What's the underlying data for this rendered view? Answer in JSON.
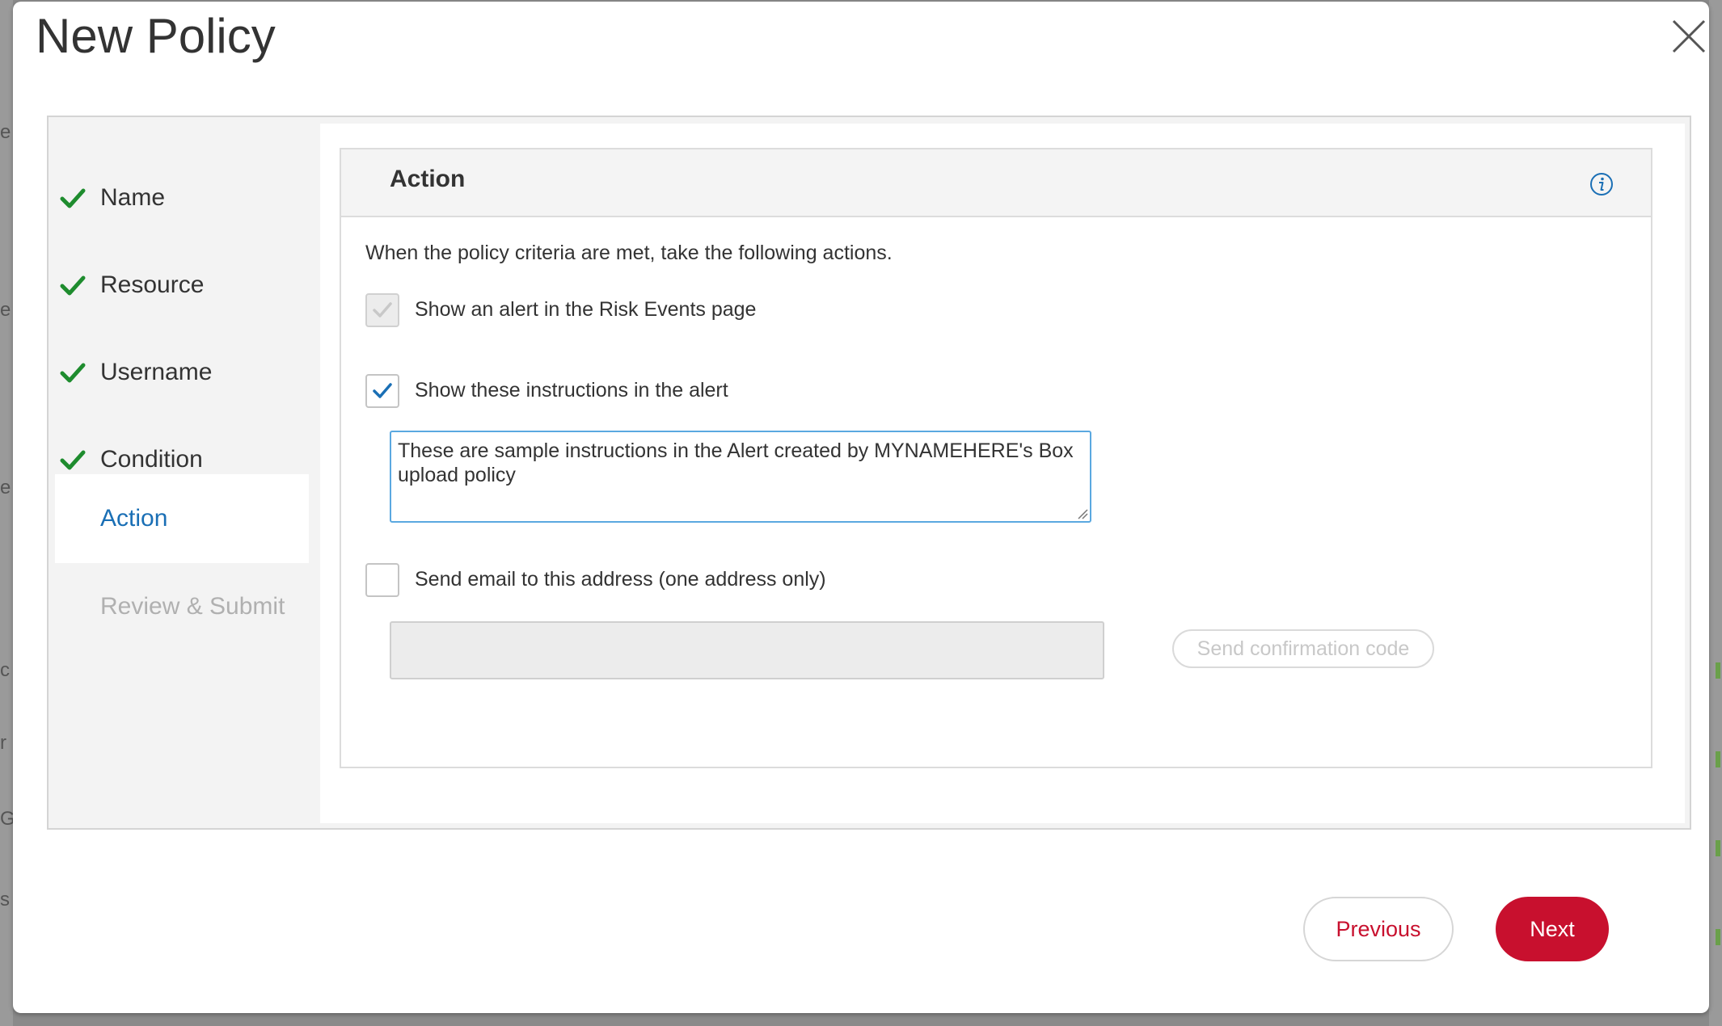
{
  "modal": {
    "title": "New Policy",
    "close_icon": "close-icon"
  },
  "steps": [
    {
      "label": "Name",
      "status": "complete"
    },
    {
      "label": "Resource",
      "status": "complete"
    },
    {
      "label": "Username",
      "status": "complete"
    },
    {
      "label": "Condition",
      "status": "complete"
    },
    {
      "label": "Action",
      "status": "active"
    },
    {
      "label": "Review & Submit",
      "status": "disabled"
    }
  ],
  "panel": {
    "title": "Action",
    "info_icon": "info-icon",
    "intro": "When the policy criteria are met, take the following actions.",
    "options": {
      "show_alert": {
        "label": "Show an alert in the Risk Events page",
        "checked": true,
        "disabled": true
      },
      "show_instructions": {
        "label": "Show these instructions in the alert",
        "checked": true,
        "disabled": false
      },
      "send_email": {
        "label": "Send email to this address (one address only)",
        "checked": false,
        "disabled": false
      }
    },
    "instructions_value": "These are sample instructions in the Alert created by MYNAMEHERE's Box upload policy",
    "email_value": "",
    "confirm_button": "Send confirmation code"
  },
  "footer": {
    "previous": "Previous",
    "next": "Next"
  },
  "colors": {
    "accent": "#c8102e",
    "link_blue": "#1a6fb5",
    "check_green": "#1e8c2e"
  }
}
